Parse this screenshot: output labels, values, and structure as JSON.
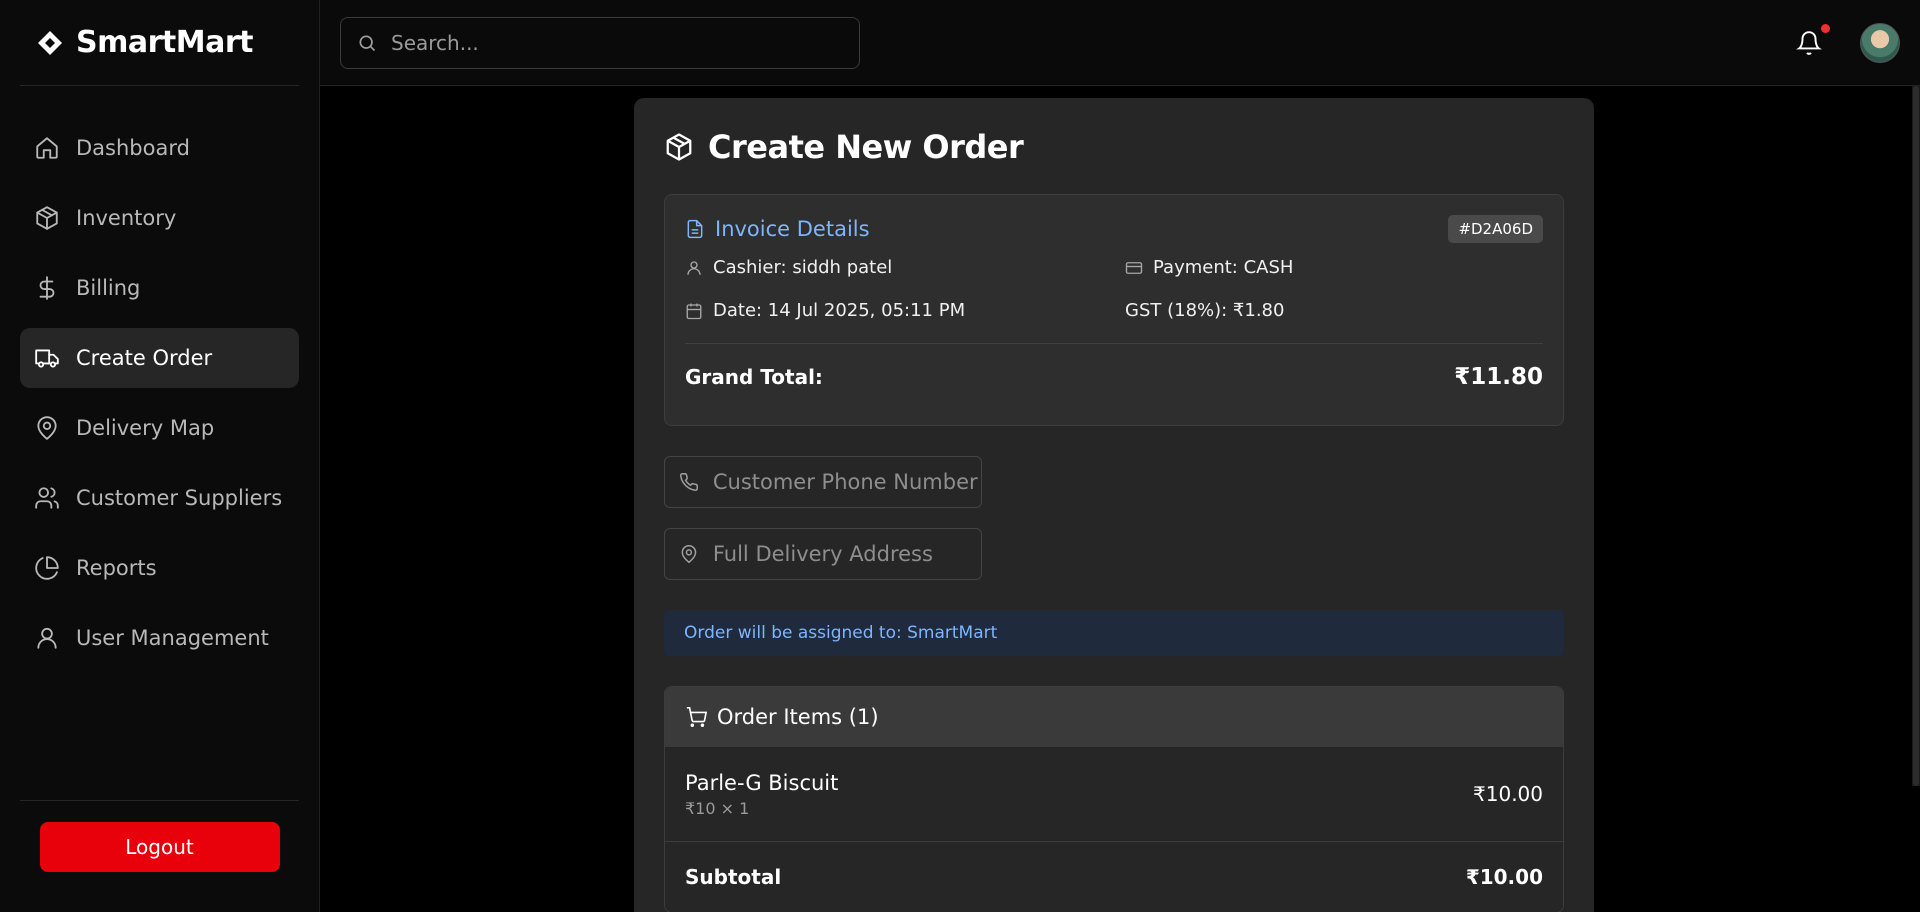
{
  "brand": {
    "name": "SmartMart"
  },
  "sidebar": {
    "items": [
      {
        "label": "Dashboard",
        "icon": "home-icon",
        "active": false
      },
      {
        "label": "Inventory",
        "icon": "package-icon",
        "active": false
      },
      {
        "label": "Billing",
        "icon": "dollar-icon",
        "active": false
      },
      {
        "label": "Create Order",
        "icon": "truck-icon",
        "active": true
      },
      {
        "label": "Delivery Map",
        "icon": "map-pin-icon",
        "active": false
      },
      {
        "label": "Customer Suppliers",
        "icon": "users-icon",
        "active": false
      },
      {
        "label": "Reports",
        "icon": "pie-chart-icon",
        "active": false
      },
      {
        "label": "User Management",
        "icon": "user-icon",
        "active": false
      }
    ],
    "logout_label": "Logout"
  },
  "topbar": {
    "search_placeholder": "Search...",
    "notification_dot_color": "#f03030"
  },
  "order": {
    "title": "Create New Order",
    "invoice": {
      "title": "Invoice Details",
      "id": "#D2A06D",
      "cashier": "Cashier: siddh patel",
      "payment": "Payment: CASH",
      "date": "Date: 14 Jul 2025, 05:11 PM",
      "gst": "GST (18%):  ₹1.80",
      "grand_total_label": "Grand Total:",
      "grand_total_value": "₹11.80"
    },
    "phone_placeholder": "Customer Phone Number",
    "address_placeholder": "Full Delivery Address",
    "assignment_text": "Order will be assigned to: SmartMart",
    "items_header": "Order Items (1)",
    "items": [
      {
        "name": "Parle-G Biscuit",
        "detail": "₹10 × 1",
        "price": "₹10.00"
      }
    ],
    "subtotal_label": "Subtotal",
    "subtotal_value": "₹10.00"
  },
  "colors": {
    "accent_blue": "#7fb4ff",
    "logout_red": "#e8000b",
    "assignment_bg": "#1f2a3d"
  }
}
